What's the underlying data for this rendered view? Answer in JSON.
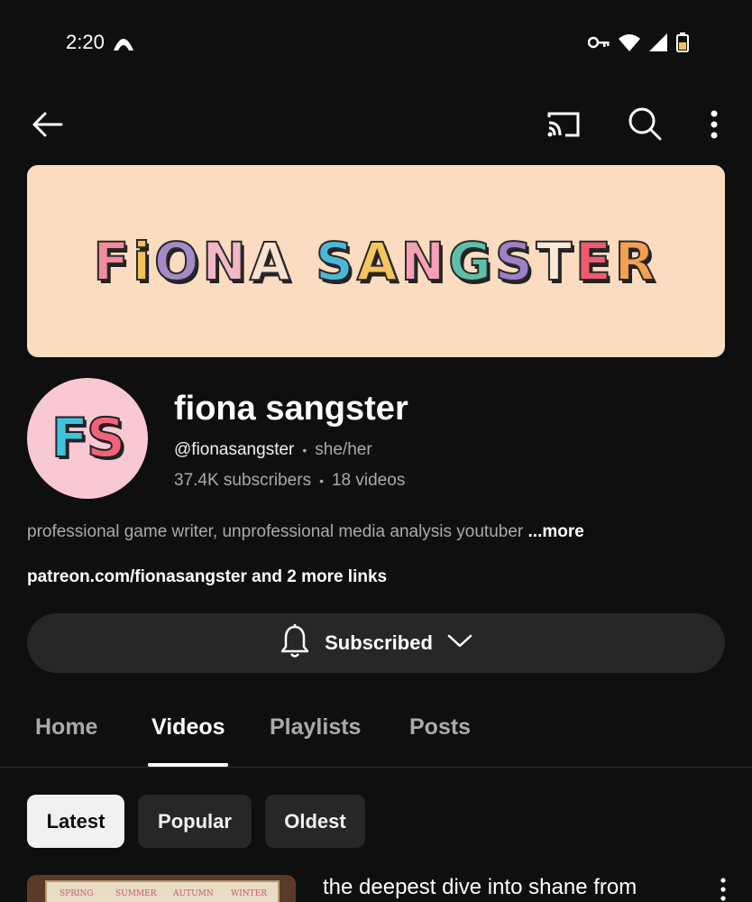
{
  "status_bar": {
    "time": "2:20"
  },
  "appbar": {
    "back_icon": "arrow-left-icon",
    "cast_icon": "cast-icon",
    "search_icon": "search-icon",
    "more_icon": "more-vert-icon"
  },
  "banner": {
    "letters": [
      {
        "ch": "F",
        "color": "#f28aa0"
      },
      {
        "ch": "i",
        "color": "#f4c25a"
      },
      {
        "ch": "O",
        "color": "#a58ac6"
      },
      {
        "ch": "N",
        "color": "#f2b8c6"
      },
      {
        "ch": "A",
        "color": "#f9e2ce"
      },
      {
        "ch": " ",
        "color": "#000000"
      },
      {
        "ch": "S",
        "color": "#4cb8d8"
      },
      {
        "ch": "A",
        "color": "#f6c560"
      },
      {
        "ch": "N",
        "color": "#f5a0b6"
      },
      {
        "ch": "G",
        "color": "#5cc0a8"
      },
      {
        "ch": "S",
        "color": "#a080c8"
      },
      {
        "ch": "T",
        "color": "#f7e9d8"
      },
      {
        "ch": "E",
        "color": "#f05a6e"
      },
      {
        "ch": "R",
        "color": "#f4a050"
      }
    ]
  },
  "channel": {
    "avatar_text_f": "F",
    "avatar_text_s": "S",
    "name": "fiona sangster",
    "handle": "@fionasangster",
    "pronouns": "she/her",
    "subscribers": "37.4K subscribers",
    "videos": "18 videos",
    "separator": "•",
    "description": "professional game writer, unprofessional media analysis youtuber",
    "more_label": "...more",
    "links": "patreon.com/fionasangster and 2 more links"
  },
  "subscribe": {
    "label": "Subscribed",
    "bell_icon": "bell-icon",
    "chevron_icon": "chevron-down-icon"
  },
  "tabs": [
    {
      "label": "Home",
      "active": false
    },
    {
      "label": "Videos",
      "active": true
    },
    {
      "label": "Playlists",
      "active": false
    },
    {
      "label": "Posts",
      "active": false
    }
  ],
  "sort_chips": [
    {
      "label": "Latest",
      "selected": true
    },
    {
      "label": "Popular",
      "selected": false
    },
    {
      "label": "Oldest",
      "selected": false
    }
  ],
  "videos": [
    {
      "title": "the deepest dive into shane from",
      "thumb_labels": [
        "SPRING",
        "SUMMER",
        "AUTUMN",
        "WINTER"
      ]
    }
  ]
}
